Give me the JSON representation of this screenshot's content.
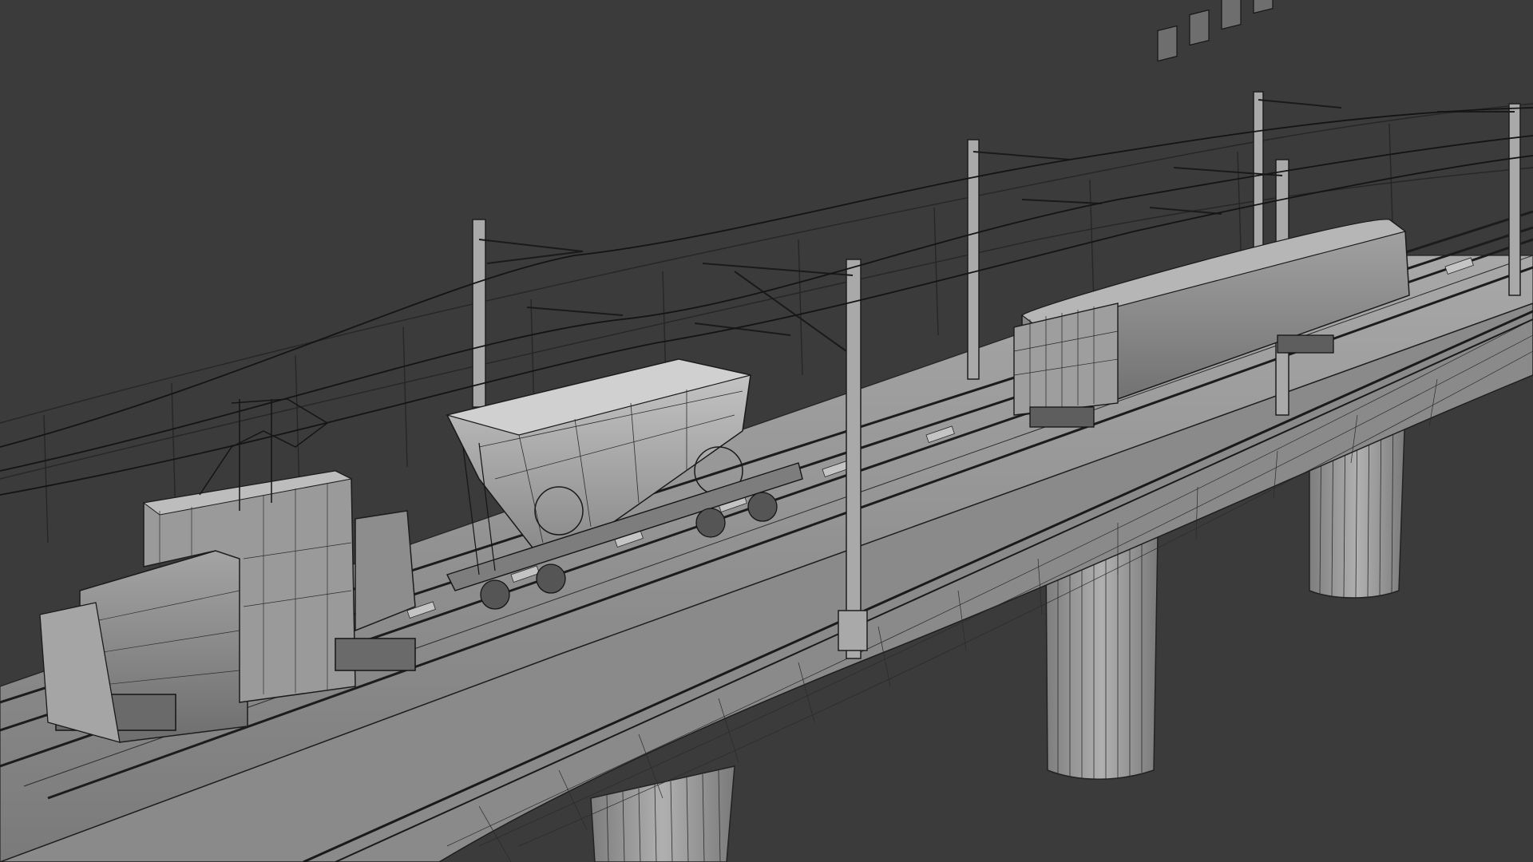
{
  "scene": {
    "background_color": "#3b3b3b",
    "mesh_fill_color": "#8f8f8f",
    "mesh_light_color": "#b4b4b4",
    "mesh_dark_color": "#6a6a6a",
    "wire_color": "#1e1e1e",
    "view_mode": "wireframe-on-shaded",
    "objects": [
      {
        "name": "viaduct-deck",
        "icon": "bridge-icon"
      },
      {
        "name": "viaduct-pier-front",
        "icon": "pillar-icon"
      },
      {
        "name": "viaduct-pier-middle",
        "icon": "pillar-icon"
      },
      {
        "name": "viaduct-pier-back",
        "icon": "pillar-icon"
      },
      {
        "name": "railway-track-near",
        "icon": "rail-icon"
      },
      {
        "name": "railway-track-far",
        "icon": "rail-icon"
      },
      {
        "name": "electric-shunting-locomotive",
        "icon": "locomotive-icon"
      },
      {
        "name": "hopper-freight-wagon",
        "icon": "wagon-icon"
      },
      {
        "name": "passenger-railcar",
        "icon": "railcar-icon"
      },
      {
        "name": "catenary-masts",
        "icon": "mast-icon"
      },
      {
        "name": "overhead-contact-wires",
        "icon": "wire-icon"
      },
      {
        "name": "background-wall",
        "icon": "wall-icon"
      }
    ]
  }
}
